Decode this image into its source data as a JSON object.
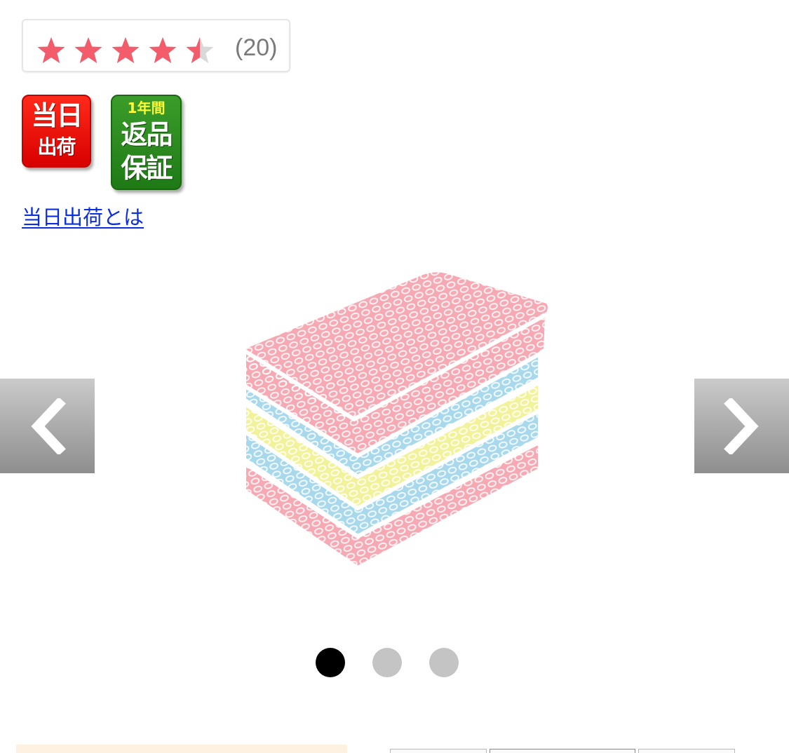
{
  "rating": {
    "stars_value": 4.5,
    "stars_max": 5,
    "count_text": "(20)",
    "star_color": "#f25c6b",
    "empty_star_color": "#d8d8d8"
  },
  "badges": {
    "same_day": {
      "line1": "当日",
      "line2": "出荷",
      "color": "#e60000"
    },
    "return_guarantee": {
      "top": "1年間",
      "line1": "返品",
      "line2": "保証",
      "color": "#2a8a1c"
    }
  },
  "same_day_link": "当日出荷とは",
  "gallery": {
    "current_slide": 1,
    "total_slides": 3,
    "prev_icon": "chevron-left-icon",
    "next_icon": "chevron-right-icon",
    "sponge_colors": [
      "#f6a8b3",
      "#a8d8ec",
      "#f2f29a",
      "#a8d8ec",
      "#f6a8b3"
    ]
  }
}
